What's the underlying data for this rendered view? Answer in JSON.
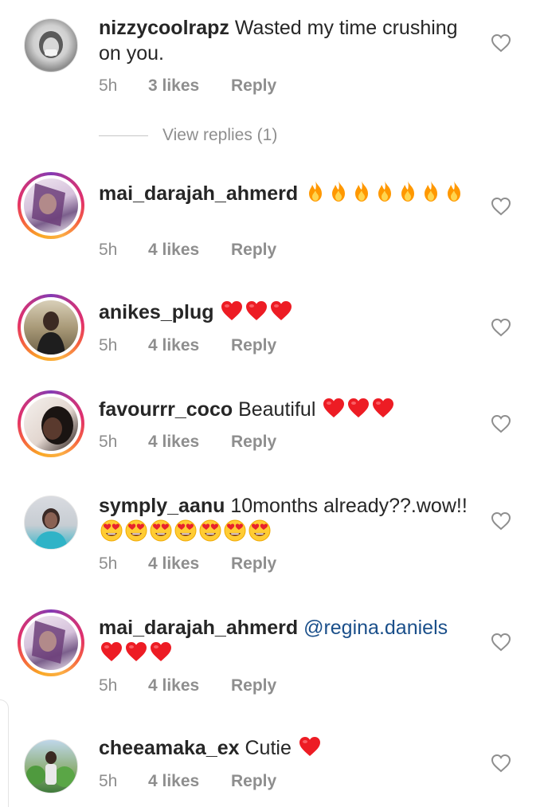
{
  "comments": [
    {
      "username": "nizzycoolrapz",
      "text": "Wasted my time crushing on you.",
      "time": "5h",
      "likes": "3 likes",
      "reply": "Reply",
      "story_ring": false,
      "view_replies": "View replies (1)"
    },
    {
      "username": "mai_darajah_ahmerd",
      "text": "",
      "emoji": [
        "fire",
        "fire",
        "fire",
        "fire",
        "fire",
        "fire",
        "fire"
      ],
      "time": "5h",
      "likes": "4 likes",
      "reply": "Reply",
      "story_ring": true
    },
    {
      "username": "anikes_plug",
      "text": "",
      "emoji": [
        "red-heart",
        "red-heart",
        "red-heart"
      ],
      "time": "5h",
      "likes": "4 likes",
      "reply": "Reply",
      "story_ring": true
    },
    {
      "username": "favourrr_coco",
      "text": "Beautiful",
      "emoji": [
        "red-heart",
        "red-heart",
        "red-heart"
      ],
      "time": "5h",
      "likes": "4 likes",
      "reply": "Reply",
      "story_ring": true
    },
    {
      "username": "symply_aanu",
      "text": "10months already??.wow!!",
      "emoji": [
        "heart-eyes",
        "heart-eyes",
        "heart-eyes",
        "heart-eyes",
        "heart-eyes",
        "heart-eyes",
        "heart-eyes"
      ],
      "time": "5h",
      "likes": "4 likes",
      "reply": "Reply",
      "story_ring": false
    },
    {
      "username": "mai_darajah_ahmerd",
      "mention": "@regina.daniels",
      "text": "",
      "emoji": [
        "red-heart",
        "red-heart",
        "red-heart"
      ],
      "time": "5h",
      "likes": "4 likes",
      "reply": "Reply",
      "story_ring": true
    },
    {
      "username": "cheeamaka_ex",
      "text": "Cutie",
      "emoji": [
        "red-heart"
      ],
      "time": "5h",
      "likes": "4 likes",
      "reply": "Reply",
      "story_ring": false
    }
  ],
  "icons": {
    "like": "heart-outline-icon"
  },
  "colors": {
    "text": "#262626",
    "secondary": "#8e8e8e",
    "mention": "#1a4f8a",
    "heart": "#ed1c24"
  }
}
